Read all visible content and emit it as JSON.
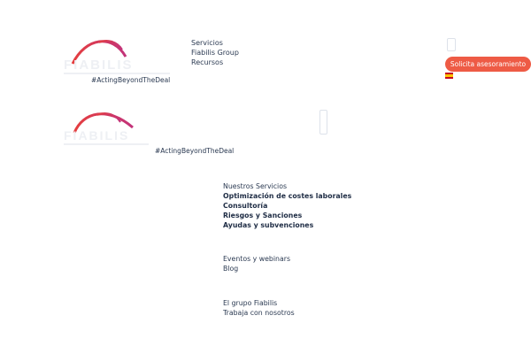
{
  "brand": {
    "logo_name": "fiabilis-logo"
  },
  "header": {
    "nav": [
      "Servicios",
      "Fiabilis Group",
      "Recursos"
    ],
    "hashtag": "#ActingBeyondTheDeal",
    "cta_label": "Solicita asesoramiento",
    "language_flag": "spain-flag-icon"
  },
  "mobile": {
    "hashtag": "#ActingBeyondTheDeal"
  },
  "menu": {
    "services_heading": "Nuestros Servicios",
    "services": [
      "Optimización de costes laborales",
      "Consultoría",
      "Riesgos y Sanciones",
      "Ayudas y subvenciones"
    ],
    "resources": [
      "Eventos y webinars",
      "Blog"
    ],
    "group": [
      "El grupo Fiabilis",
      "Trabaja con nosotros"
    ]
  },
  "colors": {
    "accent": "#ee5b45",
    "text": "#2b3a52",
    "logo_gradient_start": "#e53e3e",
    "logo_gradient_end": "#c2337a"
  }
}
